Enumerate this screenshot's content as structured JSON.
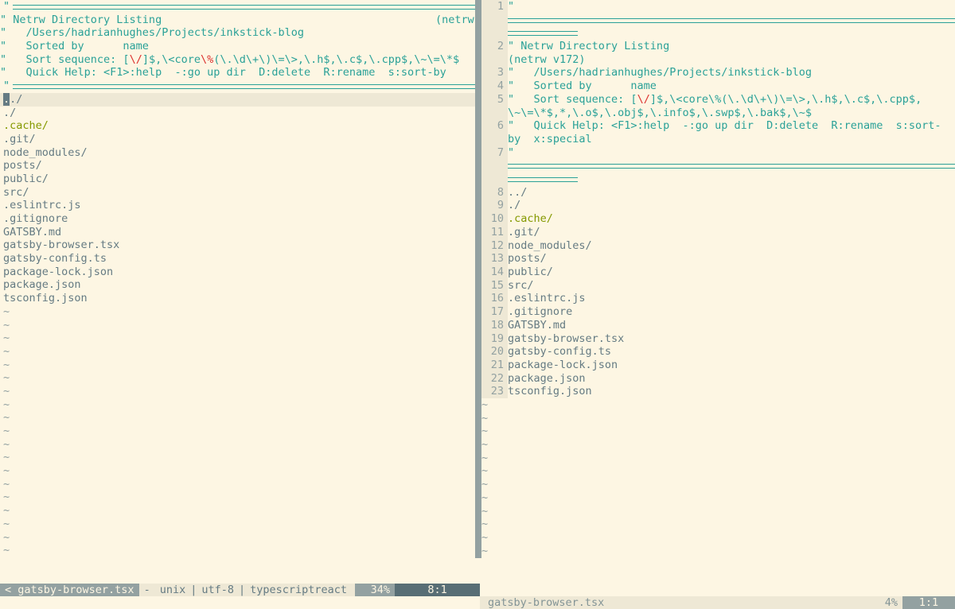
{
  "left": {
    "header": {
      "l1": "\" Netrw Directory Listing",
      "l1r": "(netrw",
      "l2": "\"   /Users/hadrianhughes/Projects/inkstick-blog",
      "l3": "\"   Sorted by      name",
      "l4a": "\"   Sort sequence: [",
      "l4b": "\\/",
      "l4c": "]$,\\<core",
      "l4d": "\\%",
      "l4e": "(\\.\\d\\+\\)\\=\\>,\\.h$,\\.c$,\\.cpp$,\\~\\=\\*$",
      "l5": "\"   Quick Help: <F1>:help  -:go up dir  D:delete  R:rename  s:sort-by"
    },
    "files": [
      "../",
      "./",
      ".cache/",
      ".git/",
      "node_modules/",
      "posts/",
      "public/",
      "src/",
      ".eslintrc.js",
      ".gitignore",
      "GATSBY.md",
      "gatsby-browser.tsx",
      "gatsby-config.ts",
      "package-lock.json",
      "package.json",
      "tsconfig.json"
    ],
    "tilde": "~"
  },
  "right": {
    "header": {
      "l1": "\"",
      "l2": "\" Netrw Directory Listing",
      "l2b": "(netrw v172)",
      "l3": "\"   /Users/hadrianhughes/Projects/inkstick-blog",
      "l4": "\"   Sorted by      name",
      "l5a": "\"   Sort sequence: [",
      "l5b": "\\/",
      "l5c": "]$,\\<core\\%(\\.\\d\\+\\)\\=\\>,\\.h$,\\.c$,\\.cpp$,",
      "l5d": "\\~\\=\\*$,*,\\.o$,\\.obj$,\\.info$,\\.swp$,\\.bak$,\\~$",
      "l6a": "\"   Quick Help: <F1>:help  -:go up dir  D:delete  R:rename  s:sort-",
      "l6b": "by  x:special",
      "l7": "\""
    },
    "line_numbers": [
      "1",
      "2",
      "3",
      "4",
      "5",
      "6",
      "7",
      "8",
      "9",
      "10",
      "11",
      "12",
      "13",
      "14",
      "15",
      "16",
      "17",
      "18",
      "19",
      "20",
      "21",
      "22",
      "23"
    ]
  },
  "status": {
    "left": {
      "file": "< gatsby-browser.tsx",
      "modified": "-",
      "format": "unix",
      "encoding": "utf-8",
      "filetype": "typescriptreact",
      "percent": "34%",
      "position": "8:1"
    },
    "right": {
      "file": "gatsby-browser.tsx",
      "percent": "4%",
      "position": "1:1"
    }
  }
}
